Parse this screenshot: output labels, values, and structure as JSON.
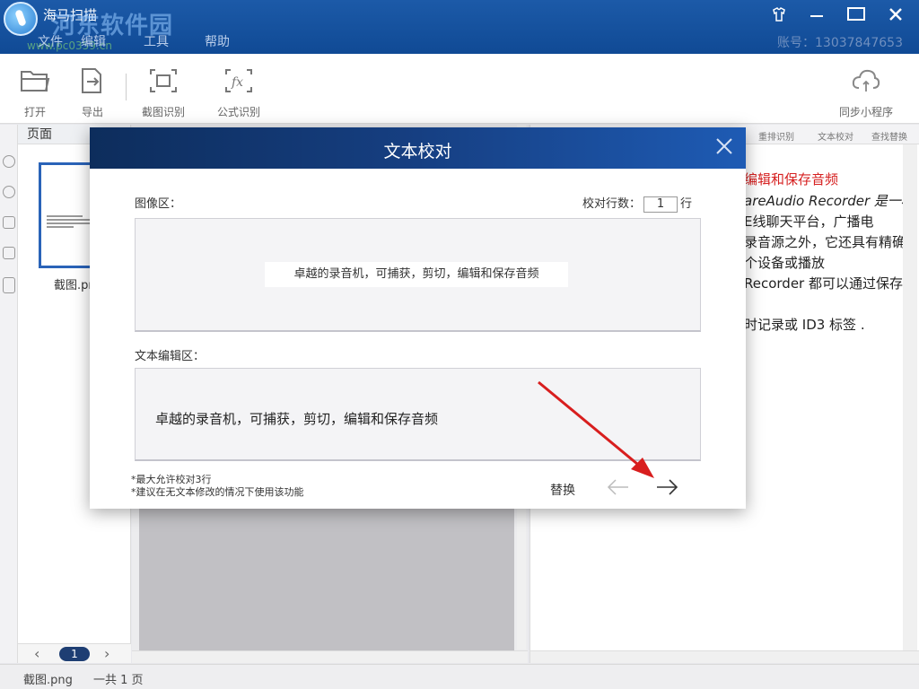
{
  "app": {
    "title": "海马扫描",
    "watermark": "河东软件园",
    "watermark_url": "www.pc0359.cn",
    "menu": [
      "文件",
      "编辑",
      "工具",
      "帮助"
    ],
    "account": "账号：13037847653"
  },
  "toolbar": {
    "open": "打开",
    "export": "导出",
    "screenshot_ocr": "截图识别",
    "formula_ocr": "公式识别",
    "sync": "同步小程序"
  },
  "pages_panel": {
    "title": "页面",
    "thumb_label": "截图.png",
    "current_page": "1"
  },
  "right_panel": {
    "tools": [
      "重排识别",
      "文本校对",
      "查找替换"
    ],
    "lines": [
      "编辑和保存音频",
      "areAudio Recorder 是一种",
      "E线聊天平台，广播电",
      "录音源之外，它还具有精确",
      "个设备或播放",
      "Recorder 都可以通过保存",
      "时记录或 ID3 标签 ."
    ]
  },
  "dialog": {
    "title": "文本校对",
    "image_label": "图像区：",
    "count_label": "校对行数：",
    "count_value": "1",
    "count_unit": "行",
    "image_text": "卓越的录音机，可捕获，剪切，编辑和保存音频",
    "edit_label": "文本编辑区：",
    "edit_text": "卓越的录音机，可捕获，剪切，编辑和保存音频",
    "note1": "*最大允许校对3行",
    "note2": "*建议在无文本修改的情况下使用该功能",
    "replace": "替换"
  },
  "status": {
    "file": "截图.png",
    "total": "一共 1 页"
  },
  "colors": {
    "title_bar": "#1c5aa8",
    "dialog_header": "#163f82",
    "red_text": "#d62020",
    "annotation_arrow": "#d81e1e"
  }
}
